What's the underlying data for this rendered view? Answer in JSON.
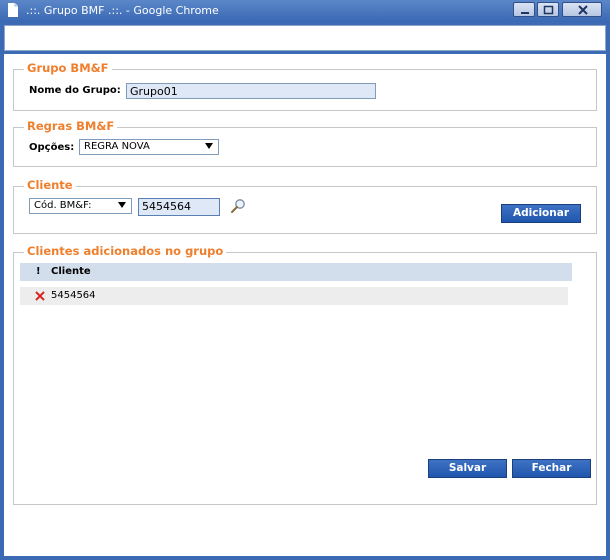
{
  "window": {
    "title": ".::. Grupo BMF .::. - Google Chrome"
  },
  "icons": {
    "document": "document-icon",
    "minimize": "minimize-icon",
    "maximize": "maximize-icon",
    "close": "close-icon",
    "search": "magnifier-icon",
    "remove": "remove-x-icon"
  },
  "group_section": {
    "legend": "Grupo BM&F",
    "name_label": "Nome do Grupo:",
    "name_value": "Grupo01"
  },
  "rules_section": {
    "legend": "Regras BM&F",
    "options_label": "Opções:",
    "options_selected": "REGRA NOVA"
  },
  "client_section": {
    "legend": "Cliente",
    "type_selected": "Cód. BM&F:",
    "code_value": "5454564",
    "add_button": "Adicionar"
  },
  "added_section": {
    "legend": "Clientes adicionados no grupo",
    "header_flag": "!",
    "header_client": "Cliente",
    "rows": [
      {
        "client": "5454564"
      }
    ]
  },
  "footer": {
    "save_button": "Salvar",
    "close_button": "Fechar"
  },
  "colors": {
    "legend": "#ef7f2c",
    "button": "#2a5fb5",
    "titlebar": "#4a78bf",
    "remove": "#d42b1f"
  }
}
